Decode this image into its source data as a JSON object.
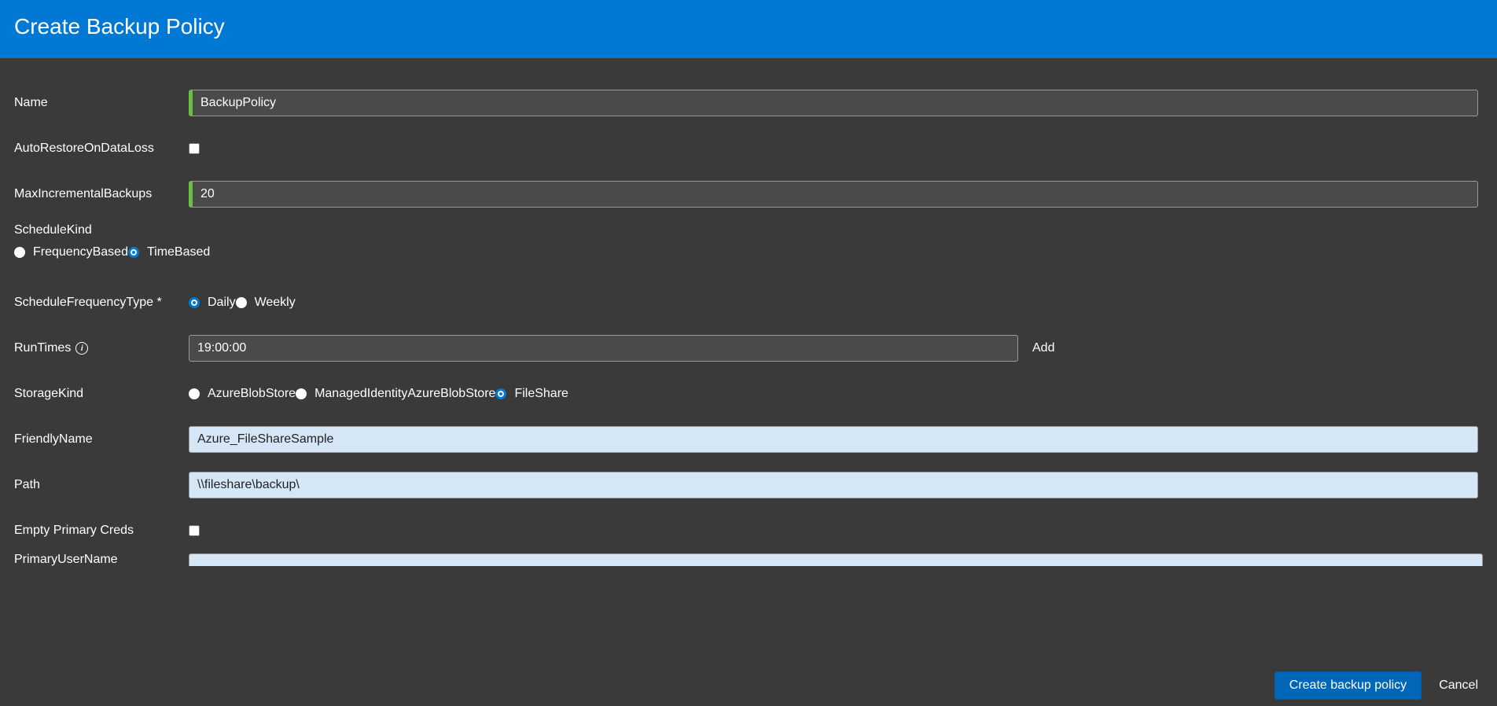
{
  "header": {
    "title": "Create Backup Policy"
  },
  "form": {
    "name": {
      "label": "Name",
      "value": "BackupPolicy"
    },
    "autoRestore": {
      "label": "AutoRestoreOnDataLoss",
      "checked": false
    },
    "maxIncremental": {
      "label": "MaxIncrementalBackups",
      "value": "20"
    },
    "scheduleKind": {
      "label": "ScheduleKind",
      "options": [
        {
          "label": "FrequencyBased",
          "checked": false
        },
        {
          "label": "TimeBased",
          "checked": true
        }
      ]
    },
    "scheduleFrequencyType": {
      "label": "ScheduleFrequencyType *",
      "options": [
        {
          "label": "Daily",
          "checked": true
        },
        {
          "label": "Weekly",
          "checked": false
        }
      ]
    },
    "runTimes": {
      "label": "RunTimes",
      "value": "19:00:00",
      "addLabel": "Add"
    },
    "storageKind": {
      "label": "StorageKind",
      "options": [
        {
          "label": "AzureBlobStore",
          "checked": false
        },
        {
          "label": "ManagedIdentityAzureBlobStore",
          "checked": false
        },
        {
          "label": "FileShare",
          "checked": true
        }
      ]
    },
    "friendlyName": {
      "label": "FriendlyName",
      "value": "Azure_FileShareSample"
    },
    "path": {
      "label": "Path",
      "value": "\\\\fileshare\\backup\\"
    },
    "emptyPrimaryCreds": {
      "label": "Empty Primary Creds",
      "checked": false
    },
    "primaryUserName": {
      "label": "PrimaryUserName",
      "value": ""
    }
  },
  "footer": {
    "primary": "Create backup policy",
    "cancel": "Cancel"
  }
}
